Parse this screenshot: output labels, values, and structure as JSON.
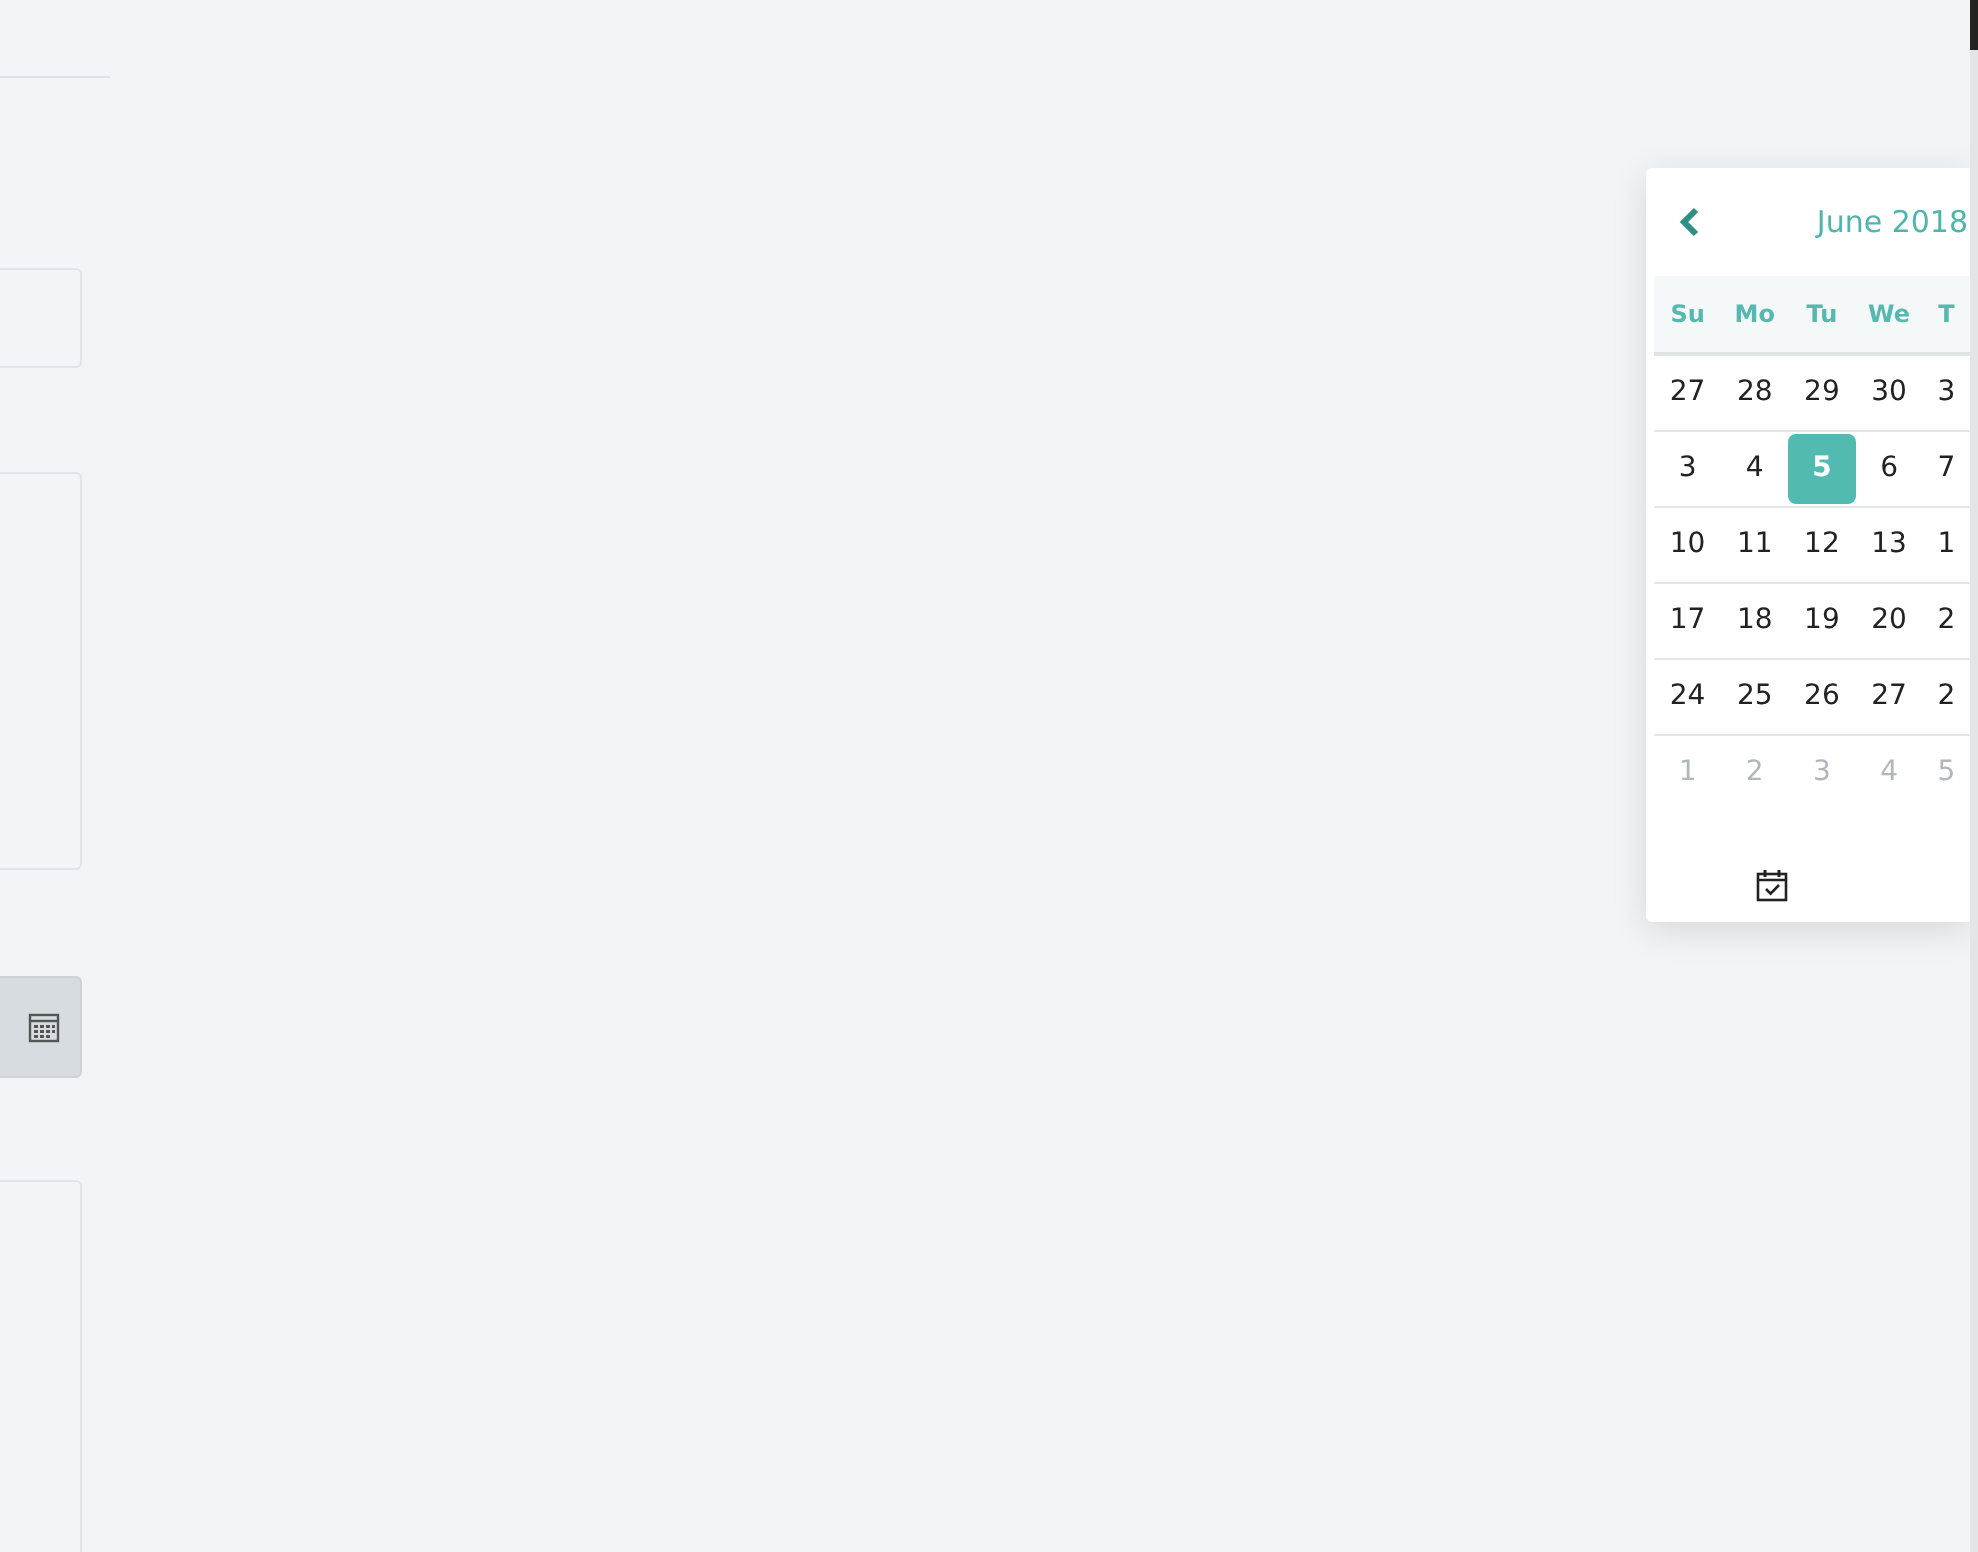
{
  "datepicker": {
    "title": "June 2018",
    "weekdays": [
      "Su",
      "Mo",
      "Tu",
      "We",
      "T"
    ],
    "weeks": [
      [
        {
          "label": "27",
          "selected": false,
          "muted": false
        },
        {
          "label": "28",
          "selected": false,
          "muted": false
        },
        {
          "label": "29",
          "selected": false,
          "muted": false
        },
        {
          "label": "30",
          "selected": false,
          "muted": false
        },
        {
          "label": "3",
          "selected": false,
          "muted": false
        }
      ],
      [
        {
          "label": "3",
          "selected": false,
          "muted": false
        },
        {
          "label": "4",
          "selected": false,
          "muted": false
        },
        {
          "label": "5",
          "selected": true,
          "muted": false
        },
        {
          "label": "6",
          "selected": false,
          "muted": false
        },
        {
          "label": "7",
          "selected": false,
          "muted": false
        }
      ],
      [
        {
          "label": "10",
          "selected": false,
          "muted": false
        },
        {
          "label": "11",
          "selected": false,
          "muted": false
        },
        {
          "label": "12",
          "selected": false,
          "muted": false
        },
        {
          "label": "13",
          "selected": false,
          "muted": false
        },
        {
          "label": "1",
          "selected": false,
          "muted": false
        }
      ],
      [
        {
          "label": "17",
          "selected": false,
          "muted": false
        },
        {
          "label": "18",
          "selected": false,
          "muted": false
        },
        {
          "label": "19",
          "selected": false,
          "muted": false
        },
        {
          "label": "20",
          "selected": false,
          "muted": false
        },
        {
          "label": "2",
          "selected": false,
          "muted": false
        }
      ],
      [
        {
          "label": "24",
          "selected": false,
          "muted": false
        },
        {
          "label": "25",
          "selected": false,
          "muted": false
        },
        {
          "label": "26",
          "selected": false,
          "muted": false
        },
        {
          "label": "27",
          "selected": false,
          "muted": false
        },
        {
          "label": "2",
          "selected": false,
          "muted": false
        }
      ],
      [
        {
          "label": "1",
          "selected": false,
          "muted": true
        },
        {
          "label": "2",
          "selected": false,
          "muted": true
        },
        {
          "label": "3",
          "selected": false,
          "muted": true
        },
        {
          "label": "4",
          "selected": false,
          "muted": true
        },
        {
          "label": "5",
          "selected": false,
          "muted": true
        }
      ]
    ]
  }
}
